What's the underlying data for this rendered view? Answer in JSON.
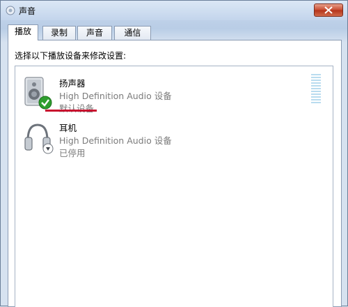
{
  "window": {
    "title": "声音",
    "close_glyph": "✕"
  },
  "tabs": [
    {
      "label": "播放",
      "active": true
    },
    {
      "label": "录制",
      "active": false
    },
    {
      "label": "声音",
      "active": false
    },
    {
      "label": "通信",
      "active": false
    }
  ],
  "playback": {
    "instruction": "选择以下播放设备来修改设置:",
    "devices": [
      {
        "name": "扬声器",
        "description": "High Definition Audio 设备",
        "status": "默认设备",
        "icon": "speaker-icon",
        "badge": "green-check-badge-icon"
      },
      {
        "name": "耳机",
        "description": "High Definition Audio 设备",
        "status": "已停用",
        "icon": "headphones-icon",
        "badge": "down-arrow-badge-icon"
      }
    ]
  },
  "colors": {
    "annotation_underline": "#c8102e",
    "status_text": "#7b7b7b",
    "default_check": "#2e9e2e"
  }
}
